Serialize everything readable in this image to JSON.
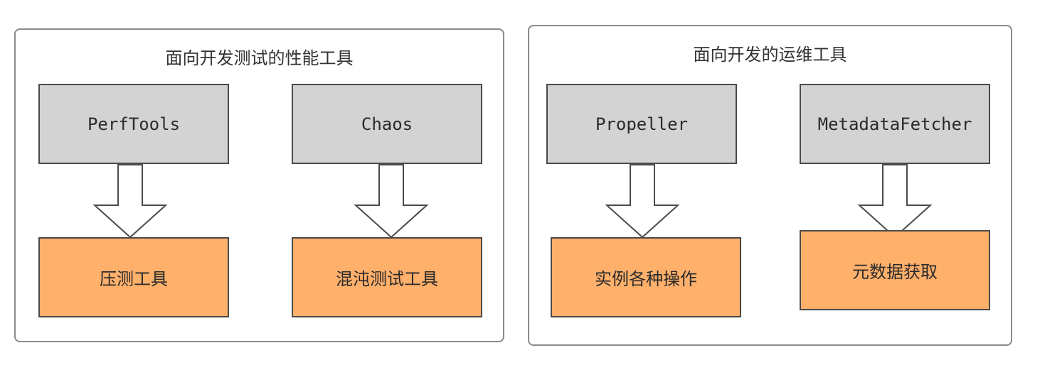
{
  "groups": [
    {
      "title": "面向开发测试的性能工具",
      "items": [
        {
          "tool": "PerfTools",
          "result": "压测工具"
        },
        {
          "tool": "Chaos",
          "result": "混沌测试工具"
        }
      ]
    },
    {
      "title": "面向开发的运维工具",
      "items": [
        {
          "tool": "Propeller",
          "result": "实例各种操作"
        },
        {
          "tool": "MetadataFetcher",
          "result": "元数据获取"
        }
      ]
    }
  ],
  "colors": {
    "tool_fill": "#d3d3d3",
    "result_fill": "#ffb06b",
    "border": "#4a4a4a",
    "group_border": "#8a8a8a"
  }
}
